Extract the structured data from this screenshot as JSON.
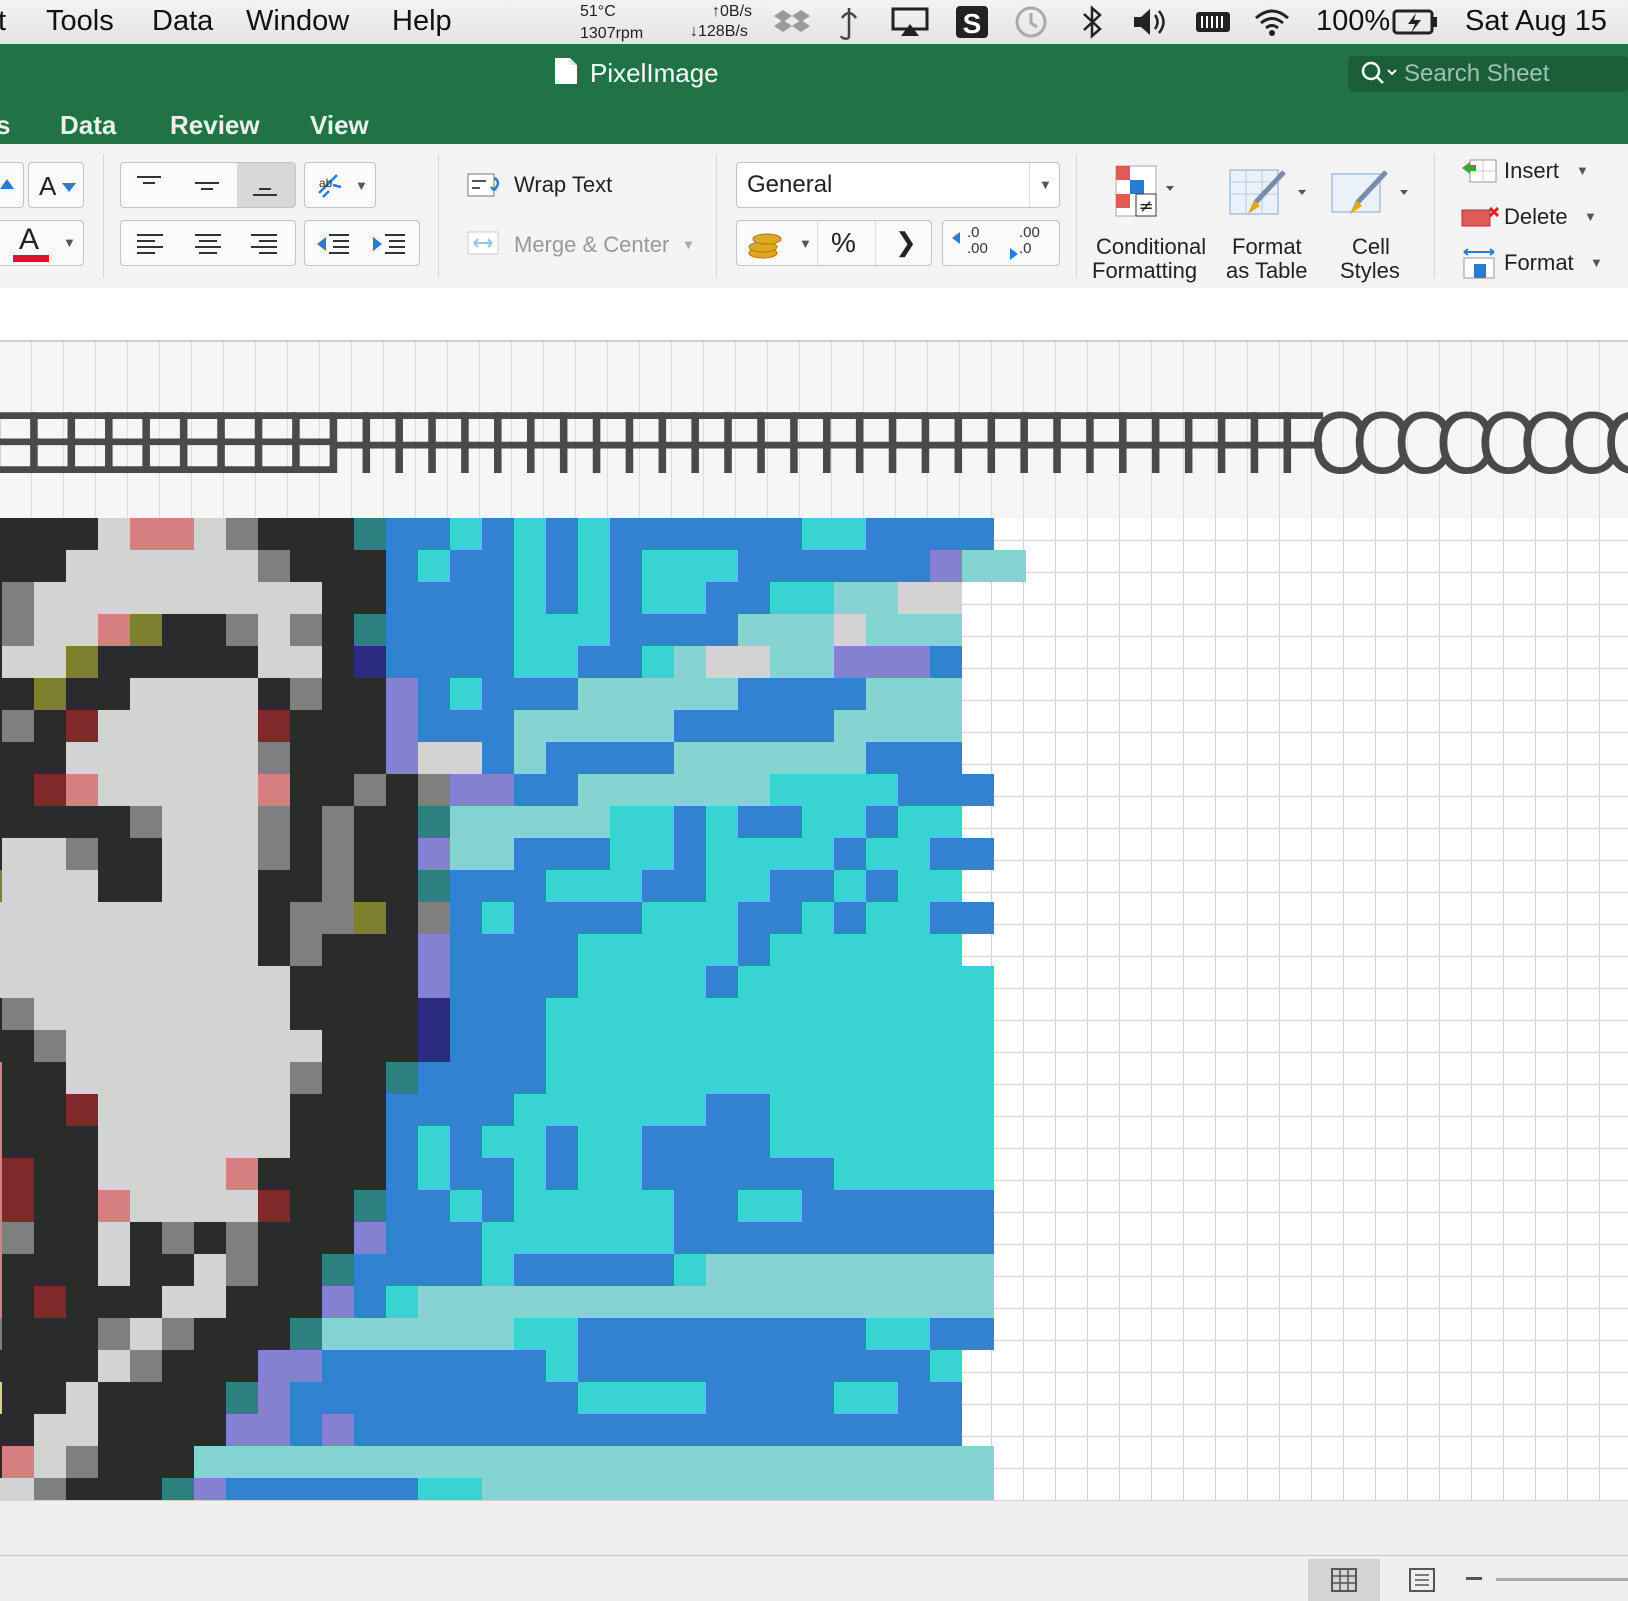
{
  "menubar": {
    "items": [
      "t",
      "Tools",
      "Data",
      "Window",
      "Help"
    ],
    "temp": "51°C",
    "fan": "1307rpm",
    "net_up": "↑0B/s",
    "net_down": "↓128B/s",
    "battery": "100%",
    "datetime": "Sat Aug 15",
    "icons": [
      "dropbox-icon",
      "shapes-icon",
      "airplay-icon",
      "s-app-icon",
      "time-machine-icon",
      "bluetooth-icon",
      "volume-icon",
      "battery-indicator-icon",
      "wifi-icon",
      "charging-battery-icon"
    ]
  },
  "window": {
    "title": "PixelImage",
    "search_placeholder": "Search Sheet"
  },
  "ribbon_tabs": [
    "s",
    "Data",
    "Review",
    "View"
  ],
  "ribbon": {
    "wrap_text": "Wrap Text",
    "merge_center": "Merge & Center",
    "number_format": "General",
    "percent": "%",
    "comma": "❯",
    "dec_increase": ".0\n.00",
    "dec_decrease": ".00\n.0",
    "conditional_formatting": [
      "Conditional",
      "Formatting"
    ],
    "format_as_table": [
      "Format",
      "as Table"
    ],
    "cell_styles": [
      "Cell",
      "Styles"
    ],
    "insert": "Insert",
    "delete": "Delete",
    "format": "Format",
    "font_color": "#e81123",
    "accent": "#217346"
  },
  "column_header_text": "EEEEEEEEEFFFFFFFFFFFFFFFFFFFFFFFFFFFFFFCCCCCCCCCCCCCCCC",
  "pixel_palette": {
    "B": "#2b2b2b",
    "W": "#d3d3d3",
    "G": "#7f7f7f",
    "P": "#d47f80",
    "O": "#7f7f30",
    "R": "#7f2a2a",
    "T": "#2e7f7f",
    "U": "#3182d0",
    "C": "#39d3d3",
    "L": "#85d4d3",
    "V": "#8481d0",
    "N": "#2b2b80",
    "Y": "#d4d47f"
  },
  "pixel_rows": [
    "BBBBWPPWGBBBTUUCUCUCUUUUUUCCUUUU",
    "BBBWWWWWWGBBBUCUUCUCUCCCUUUUUUVLL",
    "BGWWWWWWWWWBBUUUUCUCUCCUUCCLLWW",
    "BGWWPOBBGWGBTUUUUCCCUUUULLLWLLL",
    "BWWOBBBBBWWBNUUUUCCUUCLWWLLVVVU",
    "BBOBBWWWWBGBBVUCUUULLLLLUUUULLL",
    "BGBRWWWWWRBBBVUUULLLLLUUUUULLLL",
    "BBBWWWWWWGBBBVWWULUUUULLLLLLUUU",
    "BBRPWWWWWPBBGBGVVUULLLLLLCCCCUUU",
    "BBBBBGWWWGBGBBTLLLLLCCUCUUCCUCC",
    "BWWGBBWWWGBGBBVLLUUUCCUCCCCUCCUU",
    "OWWWBBWWWBBGBBTUUUCCCUUCCUUCUCC",
    "WWWWWWWWWBGGOBGUCUUUUCCCUUCUCCUU",
    "WWWWWWWWWBGBBBVUUUUCCCCCUCCCCCC",
    "WWWWWWWWWWBBBBVUUUUCCCCUCCCCCCCC",
    "BGWWWWWWWWBBBBNUUUCCCCCCCCCCCCCC",
    "BBGWWWWWWWWBBBNUUUCCCCCCCCCCCCCC",
    "PBBWWWWWWWGBBTUUUUCCCCCCCCCCCCCC",
    "PBBRWWWWWWBBBUUUUCCCCCCUUCCCCCCC",
    "PBBBWWWWWWBBBUCUCCUCCUUUUCCCCCCC",
    "PRBBWWWWPBBBBUCUUCUCCUUUUUUCCCCC",
    "PRBBPWWWWRBBTUUCUCCCCCUUCCUUUUUU",
    "PGBBWBGBGBBBVUUUCCCCCCUUUUUUUUUU",
    "PBBBWBBWGBBTUUUUCUUUUUCLLLLLLLLL",
    "PBRBBBWWBBBVUCLLLLLLLLLLLLLLLLLL",
    "GBBBGWGBBBTLLLLLLCCUUUUUUUUUCCUU",
    "BBBBWGBBBVVUUUUUUUCUUUUUUUUUUUC",
    "YBBWBBBBTVUUUUUUUUUCCCCUUUUCCUU",
    "BBWWBBBBVVUVUUUUUUUUUUUUUUUUUUU",
    "BPWGBBBLLLLLLLLLLLLLLLLLLLLLLLLL",
    "WWGBBBTVUUUUUUCCLLLLLLLLLLLLLLLL"
  ],
  "status": {
    "views": [
      "normal-view-icon",
      "page-layout-view-icon"
    ]
  }
}
